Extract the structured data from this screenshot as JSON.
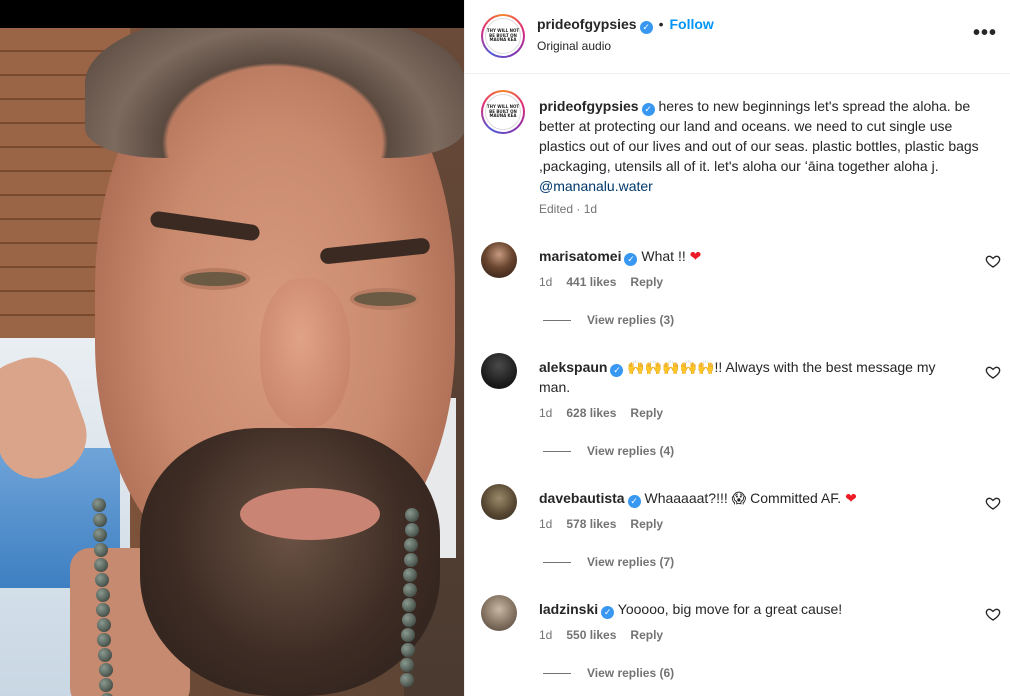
{
  "post": {
    "author": "prideofgypsies",
    "follow_label": "Follow",
    "separator": "•",
    "audio": "Original audio",
    "more_label": "•••",
    "avatar_text": "THY WILL NOT BE BUILT ON MAUNA KEA"
  },
  "caption": {
    "author": "prideofgypsies",
    "text": "heres to new beginnings let's spread the aloha. be better at protecting our land and oceans. we need to cut single use plastics out of our lives and out of our seas. plastic bottles, plastic bags ,packaging, utensils all of it. let's aloha our ʻāina together aloha j.",
    "mention": "@mananalu.water",
    "meta": "Edited · 1d"
  },
  "comments": [
    {
      "user": "marisatomei",
      "text": "What !! ",
      "emoji": "❤",
      "time": "1d",
      "likes": "441 likes",
      "reply": "Reply",
      "view_replies": "View replies (3)"
    },
    {
      "user": "alekspaun",
      "text": "🙌🙌🙌🙌🙌!! Always with the best message my man.",
      "emoji": "",
      "time": "1d",
      "likes": "628 likes",
      "reply": "Reply",
      "view_replies": "View replies (4)"
    },
    {
      "user": "davebautista",
      "text": "Whaaaaat?!!! 😱 Committed AF. ",
      "emoji": "❤",
      "time": "1d",
      "likes": "578 likes",
      "reply": "Reply",
      "view_replies": "View replies (7)"
    },
    {
      "user": "ladzinski",
      "text": "Yooooo, big move for a great cause!",
      "emoji": "",
      "time": "1d",
      "likes": "550 likes",
      "reply": "Reply",
      "view_replies": "View replies (6)"
    }
  ],
  "icons": {
    "verified": "verified-badge-icon",
    "heart": "heart-outline-icon",
    "more": "more-horizontal-icon"
  },
  "colors": {
    "accent": "#0095f6",
    "verified": "#3897f0",
    "mention": "#00376b",
    "muted": "#737373",
    "heart": "#ed1c24"
  }
}
